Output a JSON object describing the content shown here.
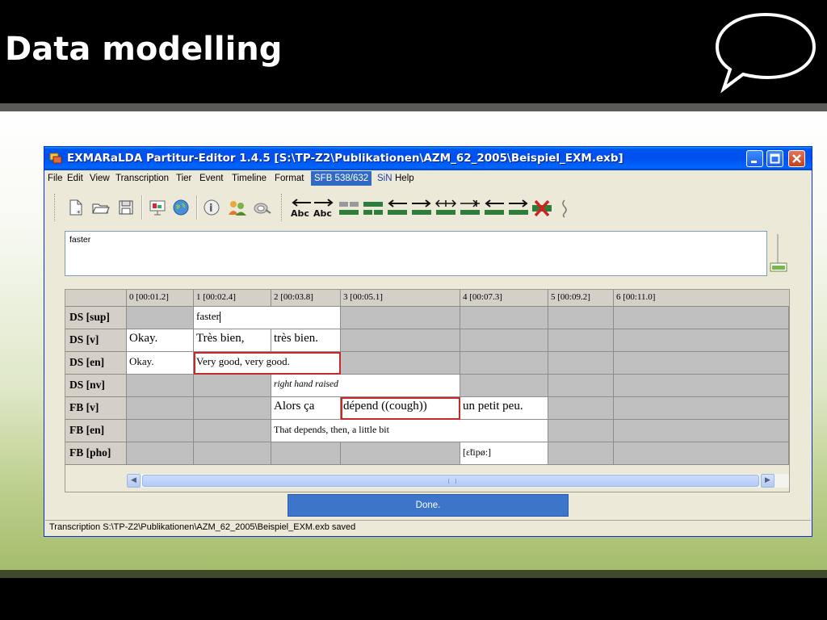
{
  "slide": {
    "title": "Data modelling"
  },
  "window": {
    "title": "EXMARaLDA Partitur-Editor 1.4.5 [S:\\TP-Z2\\Publikationen\\AZM_62_2005\\Beispiel_EXM.exb]",
    "controls": [
      "minimize",
      "maximize",
      "close"
    ]
  },
  "menu": {
    "items": [
      "File",
      "Edit",
      "View",
      "Transcription",
      "Tier",
      "Event",
      "Timeline",
      "Format",
      "SFB 538/632",
      "SiN",
      "Help"
    ],
    "highlighted": "SFB 538/632"
  },
  "toolbar": {
    "icons": [
      "new-file-icon",
      "open-folder-icon",
      "save-icon",
      "presentation-icon",
      "globe-icon",
      "info-icon",
      "speakers-icon",
      "search-icon",
      "shift-left-abc-icon",
      "shift-right-abc-icon",
      "merge-icon",
      "split-icon",
      "move-left-icon",
      "move-right-icon",
      "expand-icon",
      "shrink-icon",
      "extend-left-icon",
      "extend-right-icon",
      "delete-icon",
      "squiggle-icon"
    ],
    "abc_label": "Abc"
  },
  "editor": {
    "text": "faster"
  },
  "timeline": [
    "0 [00:01.2]",
    "1 [00:02.4]",
    "2 [00:03.8]",
    "3 [00:05.1]",
    "4 [00:07.3]",
    "5 [00:09.2]",
    "6 [00:11.0]"
  ],
  "tiers": [
    {
      "label": "DS [sup]",
      "events": [
        {
          "text": "faster",
          "cursor": true
        }
      ]
    },
    {
      "label": "DS [v]",
      "events": [
        {
          "text": "Okay."
        },
        {
          "text": "Très bien,"
        },
        {
          "text": "très bien."
        }
      ]
    },
    {
      "label": "DS [en]",
      "events": [
        {
          "text": "Okay."
        },
        {
          "text": "Very good, very good."
        }
      ]
    },
    {
      "label": "DS [nv]",
      "events": [
        {
          "text": "right hand raised"
        }
      ]
    },
    {
      "label": "FB [v]",
      "events": [
        {
          "text": "Alors ça"
        },
        {
          "text": "dépend ((cough))"
        },
        {
          "text": "un petit peu."
        }
      ]
    },
    {
      "label": "FB [en]",
      "events": [
        {
          "text": "That depends, then, a little bit"
        }
      ]
    },
    {
      "label": "FB [pho]",
      "events": [
        {
          "text": "[ɛ̃tipø:]"
        }
      ]
    }
  ],
  "progress": {
    "label": "Done.",
    "percent": 100
  },
  "status": {
    "text": "Transcription S:\\TP-Z2\\Publikationen\\AZM_62_2005\\Beispiel_EXM.exb saved"
  },
  "colors": {
    "titlebar": "#0053ee",
    "menu_highlight": "#316ac5",
    "selection_border": "#c32a2a",
    "progress": "#3c75c9"
  }
}
